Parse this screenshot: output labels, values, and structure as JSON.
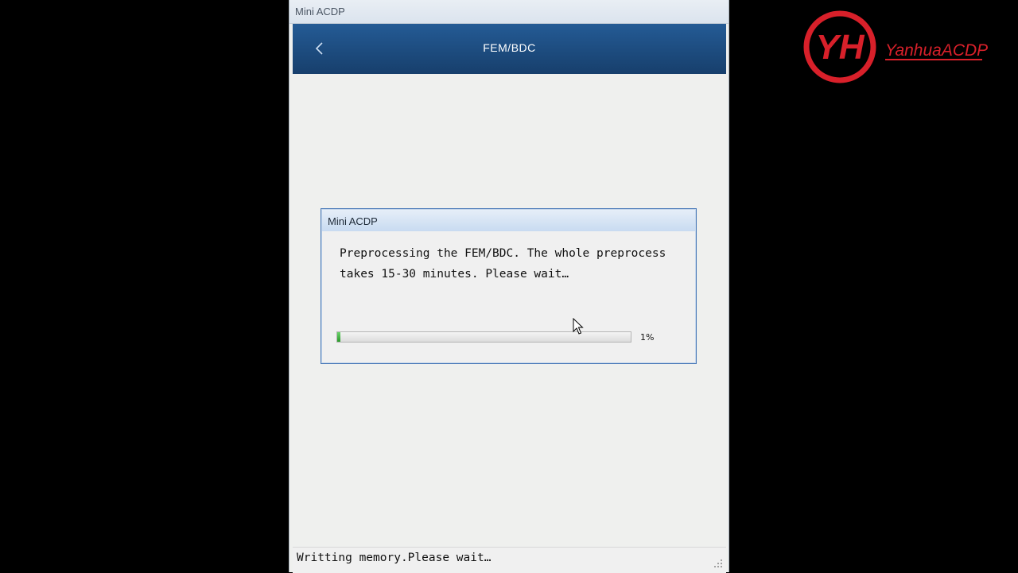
{
  "window": {
    "title": "Mini ACDP"
  },
  "header": {
    "title": "FEM/BDC",
    "back_icon": "chevron-left-icon"
  },
  "dialog": {
    "title": "Mini ACDP",
    "message": "Preprocessing the FEM/BDC. The whole preprocess takes 15-30 minutes. Please wait…",
    "progress_fraction": 0.01,
    "progress_label": "1%"
  },
  "status_bar": {
    "text": "Writting memory.Please wait…"
  },
  "watermark": {
    "brand": "YanhuaACDP",
    "logo_letters": "YH"
  },
  "colors": {
    "header_bg": "#1d4d82",
    "progress_green": "#2a9a2a",
    "logo_red": "#d8202a"
  }
}
